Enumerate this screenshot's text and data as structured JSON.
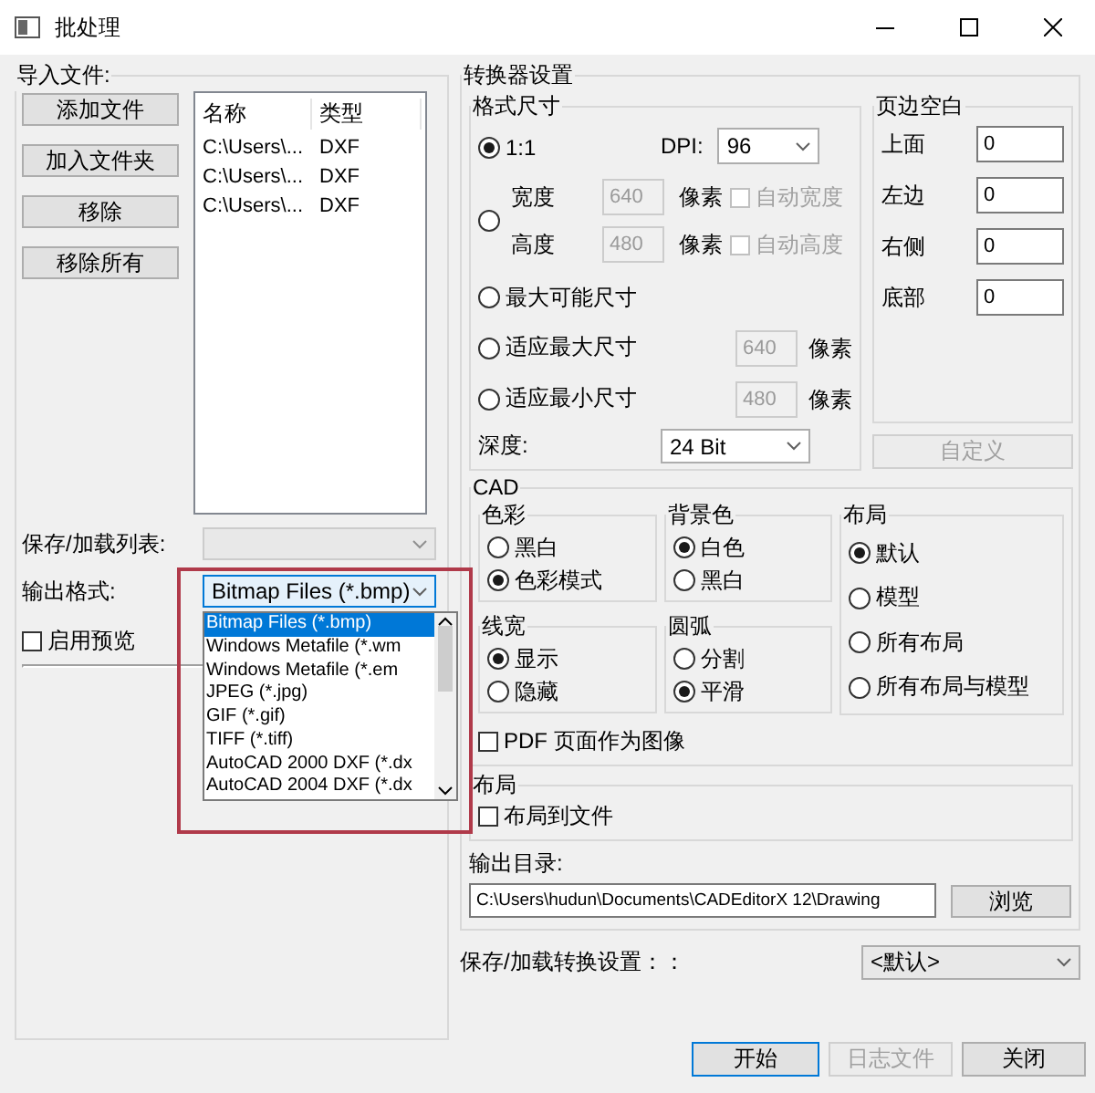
{
  "window": {
    "title": "批处理"
  },
  "import_files": {
    "title": "导入文件:",
    "buttons": [
      "添加文件",
      "加入文件夹",
      "移除",
      "移除所有"
    ],
    "file_list": {
      "columns": [
        "名称",
        "类型"
      ],
      "rows": [
        [
          "C:\\Users\\...",
          "DXF"
        ],
        [
          "C:\\Users\\...",
          "DXF"
        ],
        [
          "C:\\Users\\...",
          "DXF"
        ]
      ]
    }
  },
  "save_load_list": {
    "label": "保存/加载列表:",
    "disabled": true
  },
  "output_format": {
    "label": "输出格式:",
    "value": "Bitmap Files (*.bmp)",
    "expanded": true,
    "options": [
      {
        "label": "Bitmap Files (*.bmp)",
        "selected": true
      },
      {
        "label": "Windows Metafile (*.wm",
        "selected": false
      },
      {
        "label": "Windows Metafile (*.em",
        "selected": false
      },
      {
        "label": "JPEG (*.jpg)",
        "selected": false
      },
      {
        "label": "GIF (*.gif)",
        "selected": false
      },
      {
        "label": "TIFF (*.tiff)",
        "selected": false
      },
      {
        "label": "AutoCAD 2000 DXF (*.dx",
        "selected": false
      },
      {
        "label": "AutoCAD 2004 DXF (*.dx",
        "selected": false
      }
    ]
  },
  "preview": {
    "label": "启用预览",
    "checked": false
  },
  "converter": {
    "title": "转换器设置",
    "format_size": {
      "title": "格式尺寸",
      "options": [
        {
          "kind": "ratio",
          "label": "1:1",
          "selected": true,
          "dpi_label": "DPI:",
          "dpi": "96"
        },
        {
          "kind": "custom",
          "selected": false,
          "dims": [
            {
              "label": "宽度",
              "value": "640",
              "unit": "像素",
              "auto_label": "自动宽度",
              "auto_checked": false
            },
            {
              "label": "高度",
              "value": "480",
              "unit": "像素",
              "auto_label": "自动高度",
              "auto_checked": false
            }
          ]
        },
        {
          "kind": "plain",
          "label": "最大可能尺寸",
          "selected": false
        },
        {
          "kind": "fit",
          "label": "适应最大尺寸",
          "selected": false,
          "value": "640",
          "unit": "像素"
        },
        {
          "kind": "fit",
          "label": "适应最小尺寸",
          "selected": false,
          "value": "480",
          "unit": "像素"
        }
      ],
      "depth": {
        "label": "深度:",
        "value": "24 Bit"
      }
    },
    "margins": {
      "title": "页边空白",
      "fields": [
        {
          "label": "上面",
          "value": "0"
        },
        {
          "label": "左边",
          "value": "0"
        },
        {
          "label": "右侧",
          "value": "0"
        },
        {
          "label": "底部",
          "value": "0"
        }
      ],
      "button": {
        "label": "自定义",
        "disabled": true
      }
    },
    "cad": {
      "title": "CAD",
      "groups": [
        {
          "title": "色彩",
          "options": [
            {
              "label": "黑白",
              "selected": false
            },
            {
              "label": "色彩模式",
              "selected": true
            }
          ]
        },
        {
          "title": "背景色",
          "options": [
            {
              "label": "白色",
              "selected": true
            },
            {
              "label": "黑白",
              "selected": false
            }
          ]
        },
        {
          "title": "线宽",
          "options": [
            {
              "label": "显示",
              "selected": true
            },
            {
              "label": "隐藏",
              "selected": false
            }
          ]
        },
        {
          "title": "圆弧",
          "options": [
            {
              "label": "分割",
              "selected": false
            },
            {
              "label": "平滑",
              "selected": true
            }
          ]
        }
      ],
      "layout": {
        "title": "布局",
        "options": [
          {
            "label": "默认",
            "selected": true
          },
          {
            "label": "模型",
            "selected": false
          },
          {
            "label": "所有布局",
            "selected": false
          },
          {
            "label": "所有布局与模型",
            "selected": false
          }
        ]
      },
      "pdf_as_image": {
        "label": "PDF 页面作为图像",
        "checked": false
      }
    },
    "layout_section": {
      "title": "布局",
      "checkbox": {
        "label": "布局到文件",
        "checked": false
      }
    },
    "output_dir": {
      "label": "输出目录:",
      "value": "C:\\Users\\hudun\\Documents\\CADEditorX 12\\Drawing",
      "button": "浏览"
    }
  },
  "save_load_settings": {
    "label": "保存/加载转换设置：：",
    "value": "<默认>"
  },
  "footer_buttons": [
    {
      "label": "开始",
      "default": true,
      "disabled": false
    },
    {
      "label": "日志文件",
      "default": false,
      "disabled": true
    },
    {
      "label": "关闭",
      "default": false,
      "disabled": false
    }
  ]
}
